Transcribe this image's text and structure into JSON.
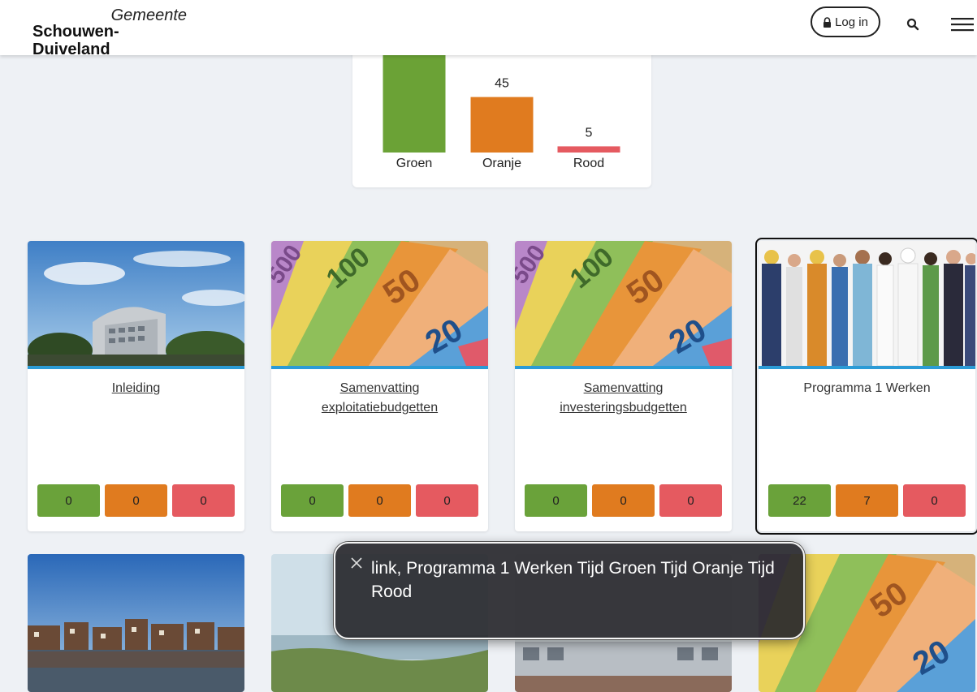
{
  "header": {
    "logo_top": "Gemeente",
    "logo_bottom": "Schouwen-Duiveland",
    "login_label": "Log in"
  },
  "chart_data": {
    "type": "bar",
    "categories": [
      "Groen",
      "Oranje",
      "Rood"
    ],
    "values": [
      null,
      45,
      5
    ],
    "data_labels": [
      "",
      "45",
      "5"
    ],
    "colors": [
      "#6ba236",
      "#e07b1f",
      "#e55a60"
    ],
    "title": "",
    "xlabel": "",
    "ylabel": ""
  },
  "tiles": [
    {
      "title": "Inleiding",
      "is_link": true,
      "image": "city-hall-building",
      "counts": [
        "0",
        "0",
        "0"
      ]
    },
    {
      "title": "Samenvatting exploitatiebudgetten",
      "is_link": true,
      "image": "euro-banknotes",
      "counts": [
        "0",
        "0",
        "0"
      ]
    },
    {
      "title": "Samenvatting investeringsbudgetten",
      "is_link": true,
      "image": "euro-banknotes",
      "counts": [
        "0",
        "0",
        "0"
      ]
    },
    {
      "title": "Programma 1 Werken",
      "is_link": false,
      "image": "workers-group",
      "counts": [
        "22",
        "7",
        "0"
      ]
    }
  ],
  "bottom_tiles": [
    {
      "image": "harbor-town"
    },
    {
      "image": "lake-shore"
    },
    {
      "image": "building"
    },
    {
      "image": "euro-banknotes"
    }
  ],
  "caption": {
    "text": "link, Programma 1 Werken Tijd Groen Tijd Oranje Tijd Rood"
  },
  "colors": {
    "green": "#6aa23a",
    "orange": "#e07b1f",
    "red": "#e55a60",
    "accent_bar": "#2b9bd6"
  }
}
